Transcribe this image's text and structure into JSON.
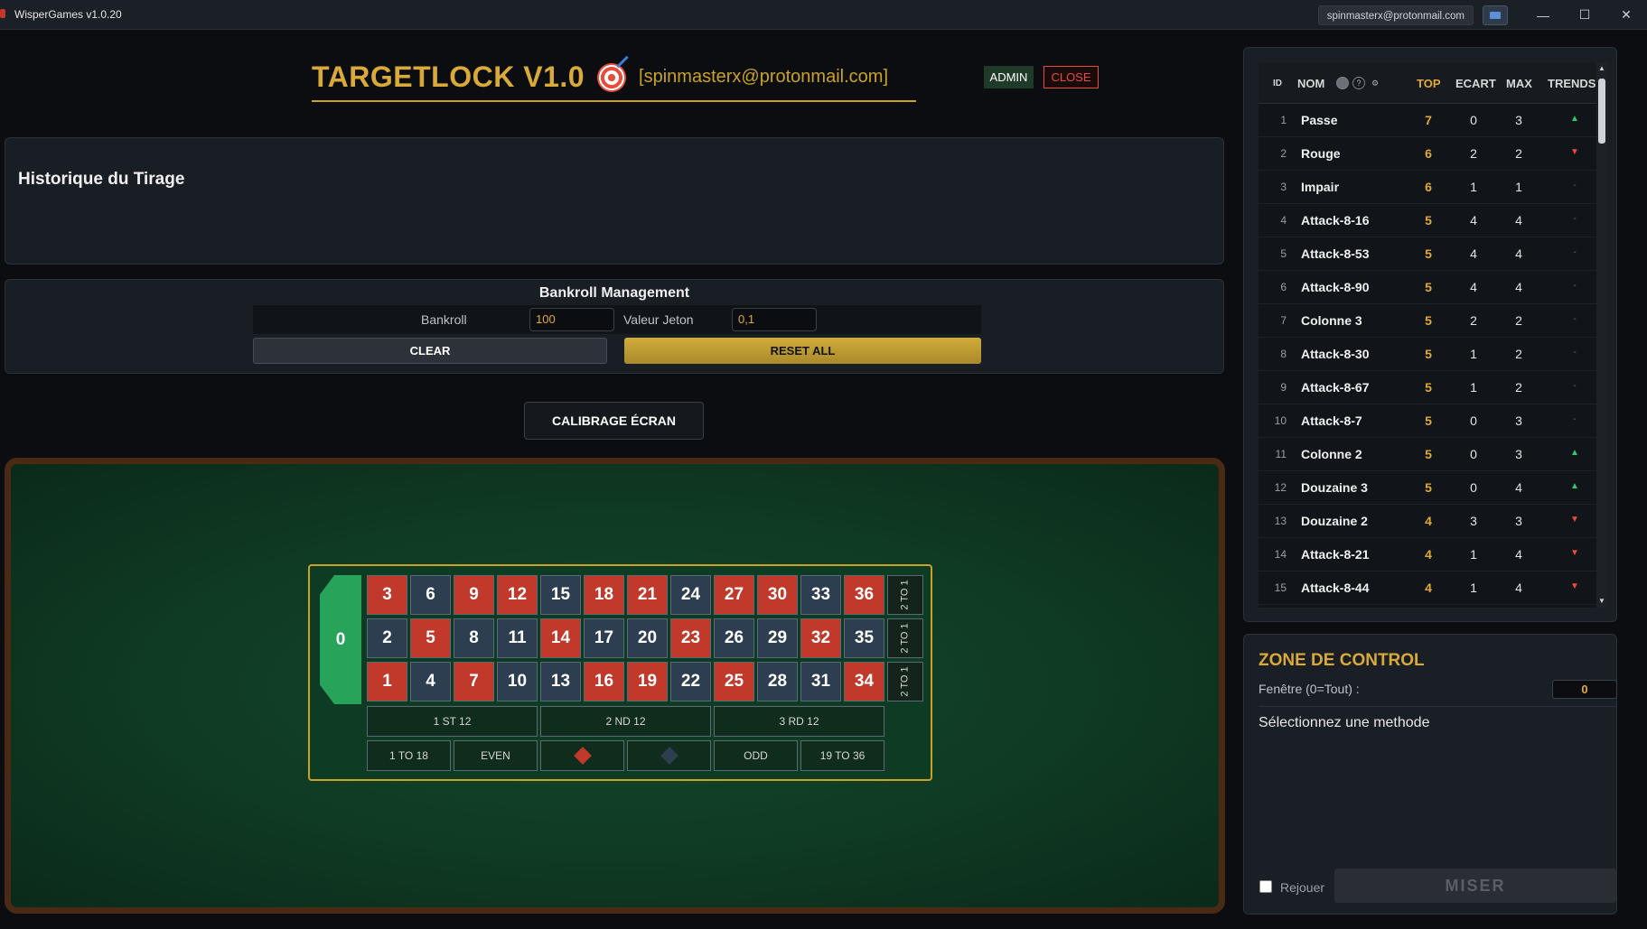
{
  "window": {
    "title": "WisperGames v1.0.20",
    "user_email": "spinmasterx@protonmail.com",
    "controls": {
      "minimize": "—",
      "maximize": "☐",
      "close": "✕"
    }
  },
  "header": {
    "title": "TARGETLOCK V1.0",
    "user_email": "[spinmasterx@protonmail.com]",
    "admin_label": "ADMIN",
    "close_label": "CLOSE"
  },
  "history": {
    "title": "Historique du Tirage"
  },
  "bankroll": {
    "title": "Bankroll Management",
    "bankroll_label": "Bankroll",
    "bankroll_value": "100",
    "chip_label": "Valeur Jeton",
    "chip_value": "0,1",
    "clear_label": "CLEAR",
    "reset_label": "RESET ALL"
  },
  "calibrate_label": "CALIBRAGE ÉCRAN",
  "roulette": {
    "zero": "0",
    "rows": [
      [
        {
          "n": "3",
          "c": "red"
        },
        {
          "n": "6",
          "c": "black"
        },
        {
          "n": "9",
          "c": "red"
        },
        {
          "n": "12",
          "c": "red"
        },
        {
          "n": "15",
          "c": "black"
        },
        {
          "n": "18",
          "c": "red"
        },
        {
          "n": "21",
          "c": "red"
        },
        {
          "n": "24",
          "c": "black"
        },
        {
          "n": "27",
          "c": "red"
        },
        {
          "n": "30",
          "c": "red"
        },
        {
          "n": "33",
          "c": "black"
        },
        {
          "n": "36",
          "c": "red"
        }
      ],
      [
        {
          "n": "2",
          "c": "black"
        },
        {
          "n": "5",
          "c": "red"
        },
        {
          "n": "8",
          "c": "black"
        },
        {
          "n": "11",
          "c": "black"
        },
        {
          "n": "14",
          "c": "red"
        },
        {
          "n": "17",
          "c": "black"
        },
        {
          "n": "20",
          "c": "black"
        },
        {
          "n": "23",
          "c": "red"
        },
        {
          "n": "26",
          "c": "black"
        },
        {
          "n": "29",
          "c": "black"
        },
        {
          "n": "32",
          "c": "red"
        },
        {
          "n": "35",
          "c": "black"
        }
      ],
      [
        {
          "n": "1",
          "c": "red"
        },
        {
          "n": "4",
          "c": "black"
        },
        {
          "n": "7",
          "c": "red"
        },
        {
          "n": "10",
          "c": "black"
        },
        {
          "n": "13",
          "c": "black"
        },
        {
          "n": "16",
          "c": "red"
        },
        {
          "n": "19",
          "c": "red"
        },
        {
          "n": "22",
          "c": "black"
        },
        {
          "n": "25",
          "c": "red"
        },
        {
          "n": "28",
          "c": "black"
        },
        {
          "n": "31",
          "c": "black"
        },
        {
          "n": "34",
          "c": "red"
        }
      ]
    ],
    "column_label": "2 TO 1",
    "dozens": [
      "1 ST 12",
      "2 ND 12",
      "3 RD 12"
    ],
    "outside": [
      "1 TO 18",
      "EVEN",
      "",
      "",
      "ODD",
      "19 TO 36"
    ],
    "colors": {
      "red": "#c0392b",
      "black": "#2c3e50",
      "green": "#27a35a"
    }
  },
  "stats": {
    "headers": {
      "id": "ID",
      "nom": "NOM",
      "top": "TOP",
      "ecart": "ECART",
      "max": "MAX",
      "trends": "TRENDS"
    },
    "header_icons": [
      "toggle-icon",
      "help-icon",
      "settings-icon"
    ],
    "rows": [
      {
        "id": "1",
        "nom": "Passe",
        "top": "7",
        "ecart": "0",
        "max": "3",
        "trend": "up"
      },
      {
        "id": "2",
        "nom": "Rouge",
        "top": "6",
        "ecart": "2",
        "max": "2",
        "trend": "down"
      },
      {
        "id": "3",
        "nom": "Impair",
        "top": "6",
        "ecart": "1",
        "max": "1",
        "trend": "flat"
      },
      {
        "id": "4",
        "nom": "Attack-8-16",
        "top": "5",
        "ecart": "4",
        "max": "4",
        "trend": "flat"
      },
      {
        "id": "5",
        "nom": "Attack-8-53",
        "top": "5",
        "ecart": "4",
        "max": "4",
        "trend": "flat"
      },
      {
        "id": "6",
        "nom": "Attack-8-90",
        "top": "5",
        "ecart": "4",
        "max": "4",
        "trend": "flat"
      },
      {
        "id": "7",
        "nom": "Colonne 3",
        "top": "5",
        "ecart": "2",
        "max": "2",
        "trend": "flat"
      },
      {
        "id": "8",
        "nom": "Attack-8-30",
        "top": "5",
        "ecart": "1",
        "max": "2",
        "trend": "flat"
      },
      {
        "id": "9",
        "nom": "Attack-8-67",
        "top": "5",
        "ecart": "1",
        "max": "2",
        "trend": "flat"
      },
      {
        "id": "10",
        "nom": "Attack-8-7",
        "top": "5",
        "ecart": "0",
        "max": "3",
        "trend": "flat"
      },
      {
        "id": "11",
        "nom": "Colonne 2",
        "top": "5",
        "ecart": "0",
        "max": "3",
        "trend": "up"
      },
      {
        "id": "12",
        "nom": "Douzaine 3",
        "top": "5",
        "ecart": "0",
        "max": "4",
        "trend": "up"
      },
      {
        "id": "13",
        "nom": "Douzaine 2",
        "top": "4",
        "ecart": "3",
        "max": "3",
        "trend": "down"
      },
      {
        "id": "14",
        "nom": "Attack-8-21",
        "top": "4",
        "ecart": "1",
        "max": "4",
        "trend": "down"
      },
      {
        "id": "15",
        "nom": "Attack-8-44",
        "top": "4",
        "ecart": "1",
        "max": "4",
        "trend": "down"
      }
    ],
    "trend_glyphs": {
      "up": "▲",
      "down": "▼",
      "flat": "-"
    }
  },
  "control": {
    "title": "ZONE DE CONTROL",
    "window_label": "Fenêtre (0=Tout) :",
    "window_value": "0",
    "method_placeholder": "Sélectionnez une methode",
    "replay_label": "Rejouer",
    "bet_label": "MISER"
  }
}
